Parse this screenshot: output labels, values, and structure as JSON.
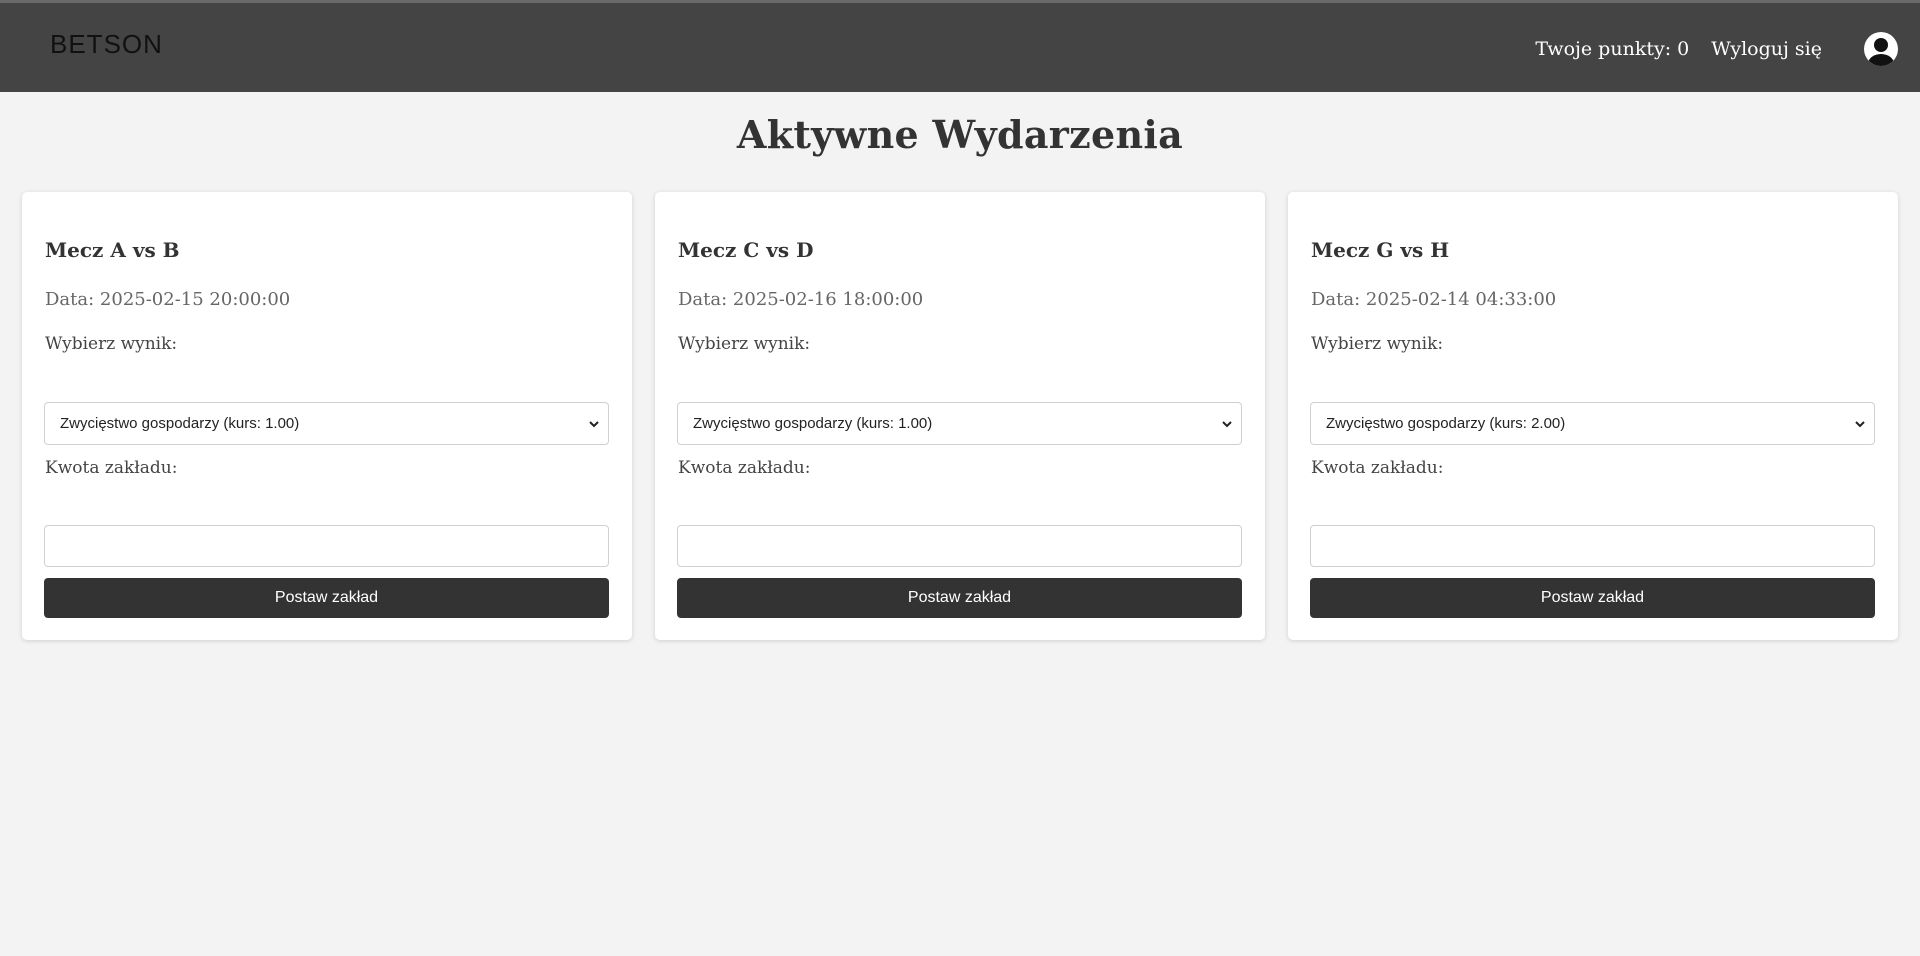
{
  "header": {
    "logo_text": "BETSON",
    "points_label": "Twoje punkty: 0",
    "logout_label": "Wyloguj się",
    "avatar_icon": "user-avatar-icon",
    "background_color": "#444444"
  },
  "main": {
    "title": "Aktywne Wydarzenia"
  },
  "events": [
    {
      "title": "Mecz A vs B",
      "date": "Data: 2025-02-15 20:00:00",
      "result_label": "Wybierz wynik:",
      "selected_option": "Zwycięstwo gospodarzy (kurs: 1.00)",
      "amount_label": "Kwota zakładu:",
      "amount_value": "",
      "button_label": "Postaw zakład"
    },
    {
      "title": "Mecz C vs D",
      "date": "Data: 2025-02-16 18:00:00",
      "result_label": "Wybierz wynik:",
      "selected_option": "Zwycięstwo gospodarzy (kurs: 1.00)",
      "amount_label": "Kwota zakładu:",
      "amount_value": "",
      "button_label": "Postaw zakład"
    },
    {
      "title": "Mecz G vs H",
      "date": "Data: 2025-02-14 04:33:00",
      "result_label": "Wybierz wynik:",
      "selected_option": "Zwycięstwo gospodarzy (kurs: 2.00)",
      "amount_label": "Kwota zakładu:",
      "amount_value": "",
      "button_label": "Postaw zakład"
    }
  ],
  "colors": {
    "page_background": "#f3f3f3",
    "button_background": "#333333",
    "card_background": "#ffffff"
  }
}
